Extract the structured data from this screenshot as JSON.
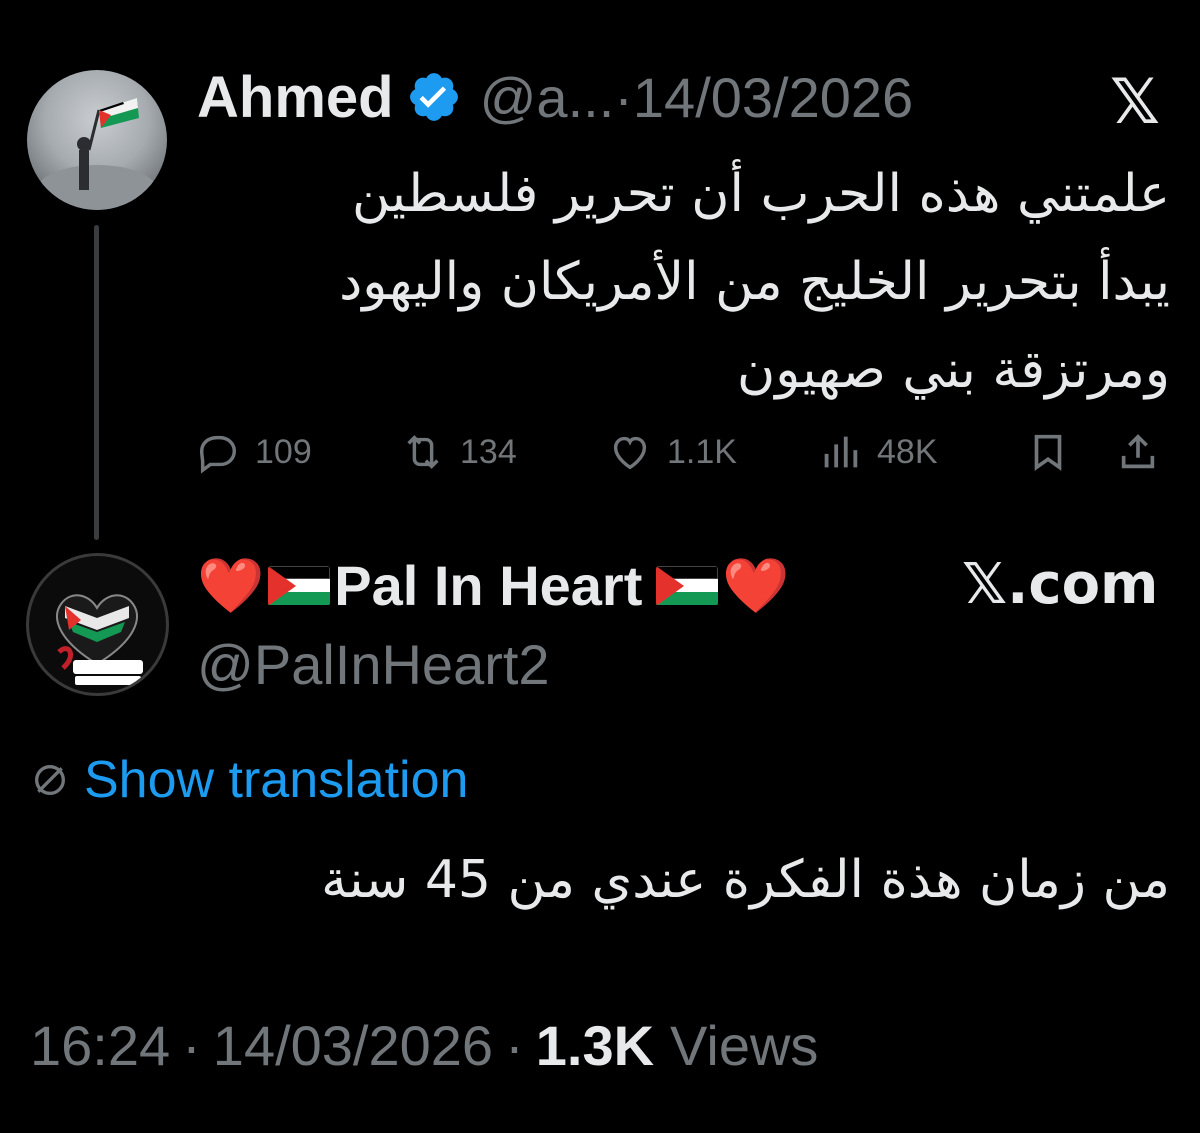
{
  "original_tweet": {
    "display_name": "Ahmed",
    "verified_icon": "verified-badge-icon",
    "handle": "@a...",
    "separator": "·",
    "date": "14/03/2026",
    "logo": "𝕏",
    "text_lines": [
      "علمتني هذه الحرب أن تحرير فلسطين",
      "يبدأ بتحرير الخليج من الأمريكان واليهود",
      "ومرتزقة بني صهيون"
    ],
    "actions": {
      "replies": "109",
      "retweets": "134",
      "likes": "1.1K",
      "views": "48K"
    }
  },
  "reply_tweet": {
    "heart_left": "❤️",
    "display_name": "Pal In Heart",
    "heart_right": "❤️",
    "source": "𝕏.com",
    "handle": "@PalInHeart2",
    "translate_label": "Show translation",
    "text": "من زمان هذة الفكرة عندي من 45 سنة",
    "time": "16:24",
    "separator": "·",
    "date": "14/03/2026",
    "views_count": "1.3K",
    "views_label": "Views"
  },
  "colors": {
    "background": "#000000",
    "text": "#e7e9ea",
    "muted": "#71767b",
    "link": "#1d9bf0",
    "verified": "#1d9bf0"
  }
}
